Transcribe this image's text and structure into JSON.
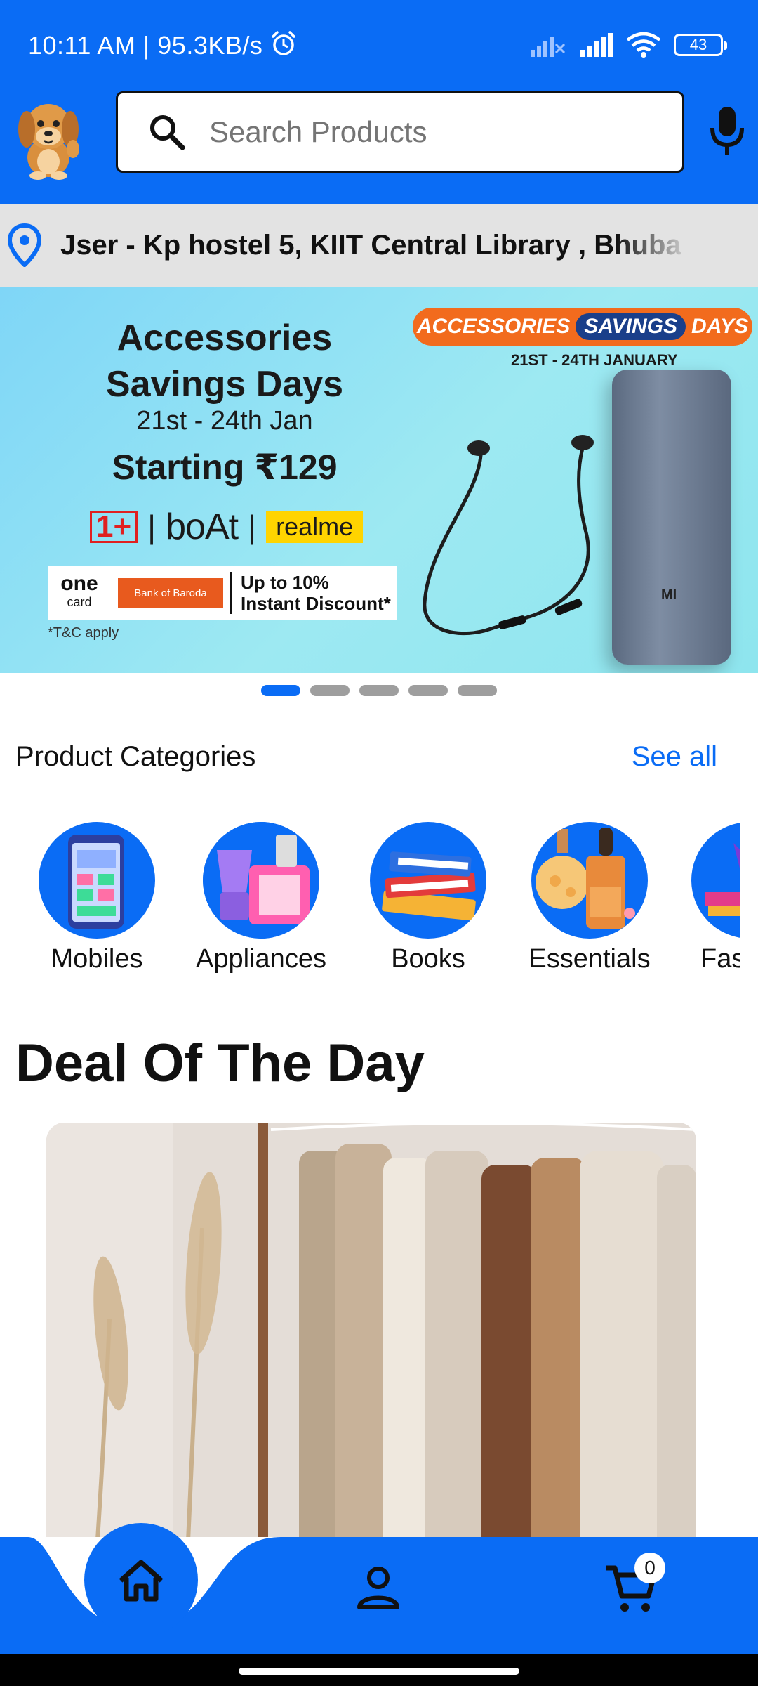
{
  "status_bar": {
    "time": "10:11 AM | 95.3KB/s",
    "battery": "43"
  },
  "header": {
    "search_placeholder": "Search Products"
  },
  "location": {
    "text": "Jser - Kp hostel 5, KIIT Central Library , Bhuba"
  },
  "banner": {
    "title_line1": "Accessories",
    "title_line2": "Savings Days",
    "dates": "21st - 24th Jan",
    "price": "Starting ₹129",
    "brands": [
      "1+",
      "boAt",
      "realme"
    ],
    "offer_card": "one",
    "offer_card_sub": "card",
    "offer_bank": "Bank of Baroda",
    "offer_text_line1": "Up to 10%",
    "offer_text_line2": "Instant Discount*",
    "tc": "*T&C apply",
    "ribbon_part1": "ACCESSORIES",
    "ribbon_part2": "SAVINGS",
    "ribbon_part3": "DAYS",
    "ribbon_sub": "21ST - 24TH JANUARY",
    "powerbank_logo": "MI",
    "slides_total": 5,
    "active_slide": 1
  },
  "categories": {
    "title": "Product Categories",
    "see_all": "See all",
    "items": [
      {
        "label": "Mobiles",
        "icon": "mobile-phone-icon"
      },
      {
        "label": "Appliances",
        "icon": "appliances-icon"
      },
      {
        "label": "Books",
        "icon": "books-icon"
      },
      {
        "label": "Essentials",
        "icon": "essentials-bottle-icon"
      },
      {
        "label": "Fas",
        "icon": "fashion-icon"
      }
    ]
  },
  "deal": {
    "title": "Deal Of The Day"
  },
  "bottom_nav": {
    "cart_count": "0",
    "items": [
      "home-icon",
      "profile-icon",
      "cart-icon"
    ]
  },
  "colors": {
    "primary": "#0a6cf5",
    "location_bg": "#e3e3e3"
  }
}
